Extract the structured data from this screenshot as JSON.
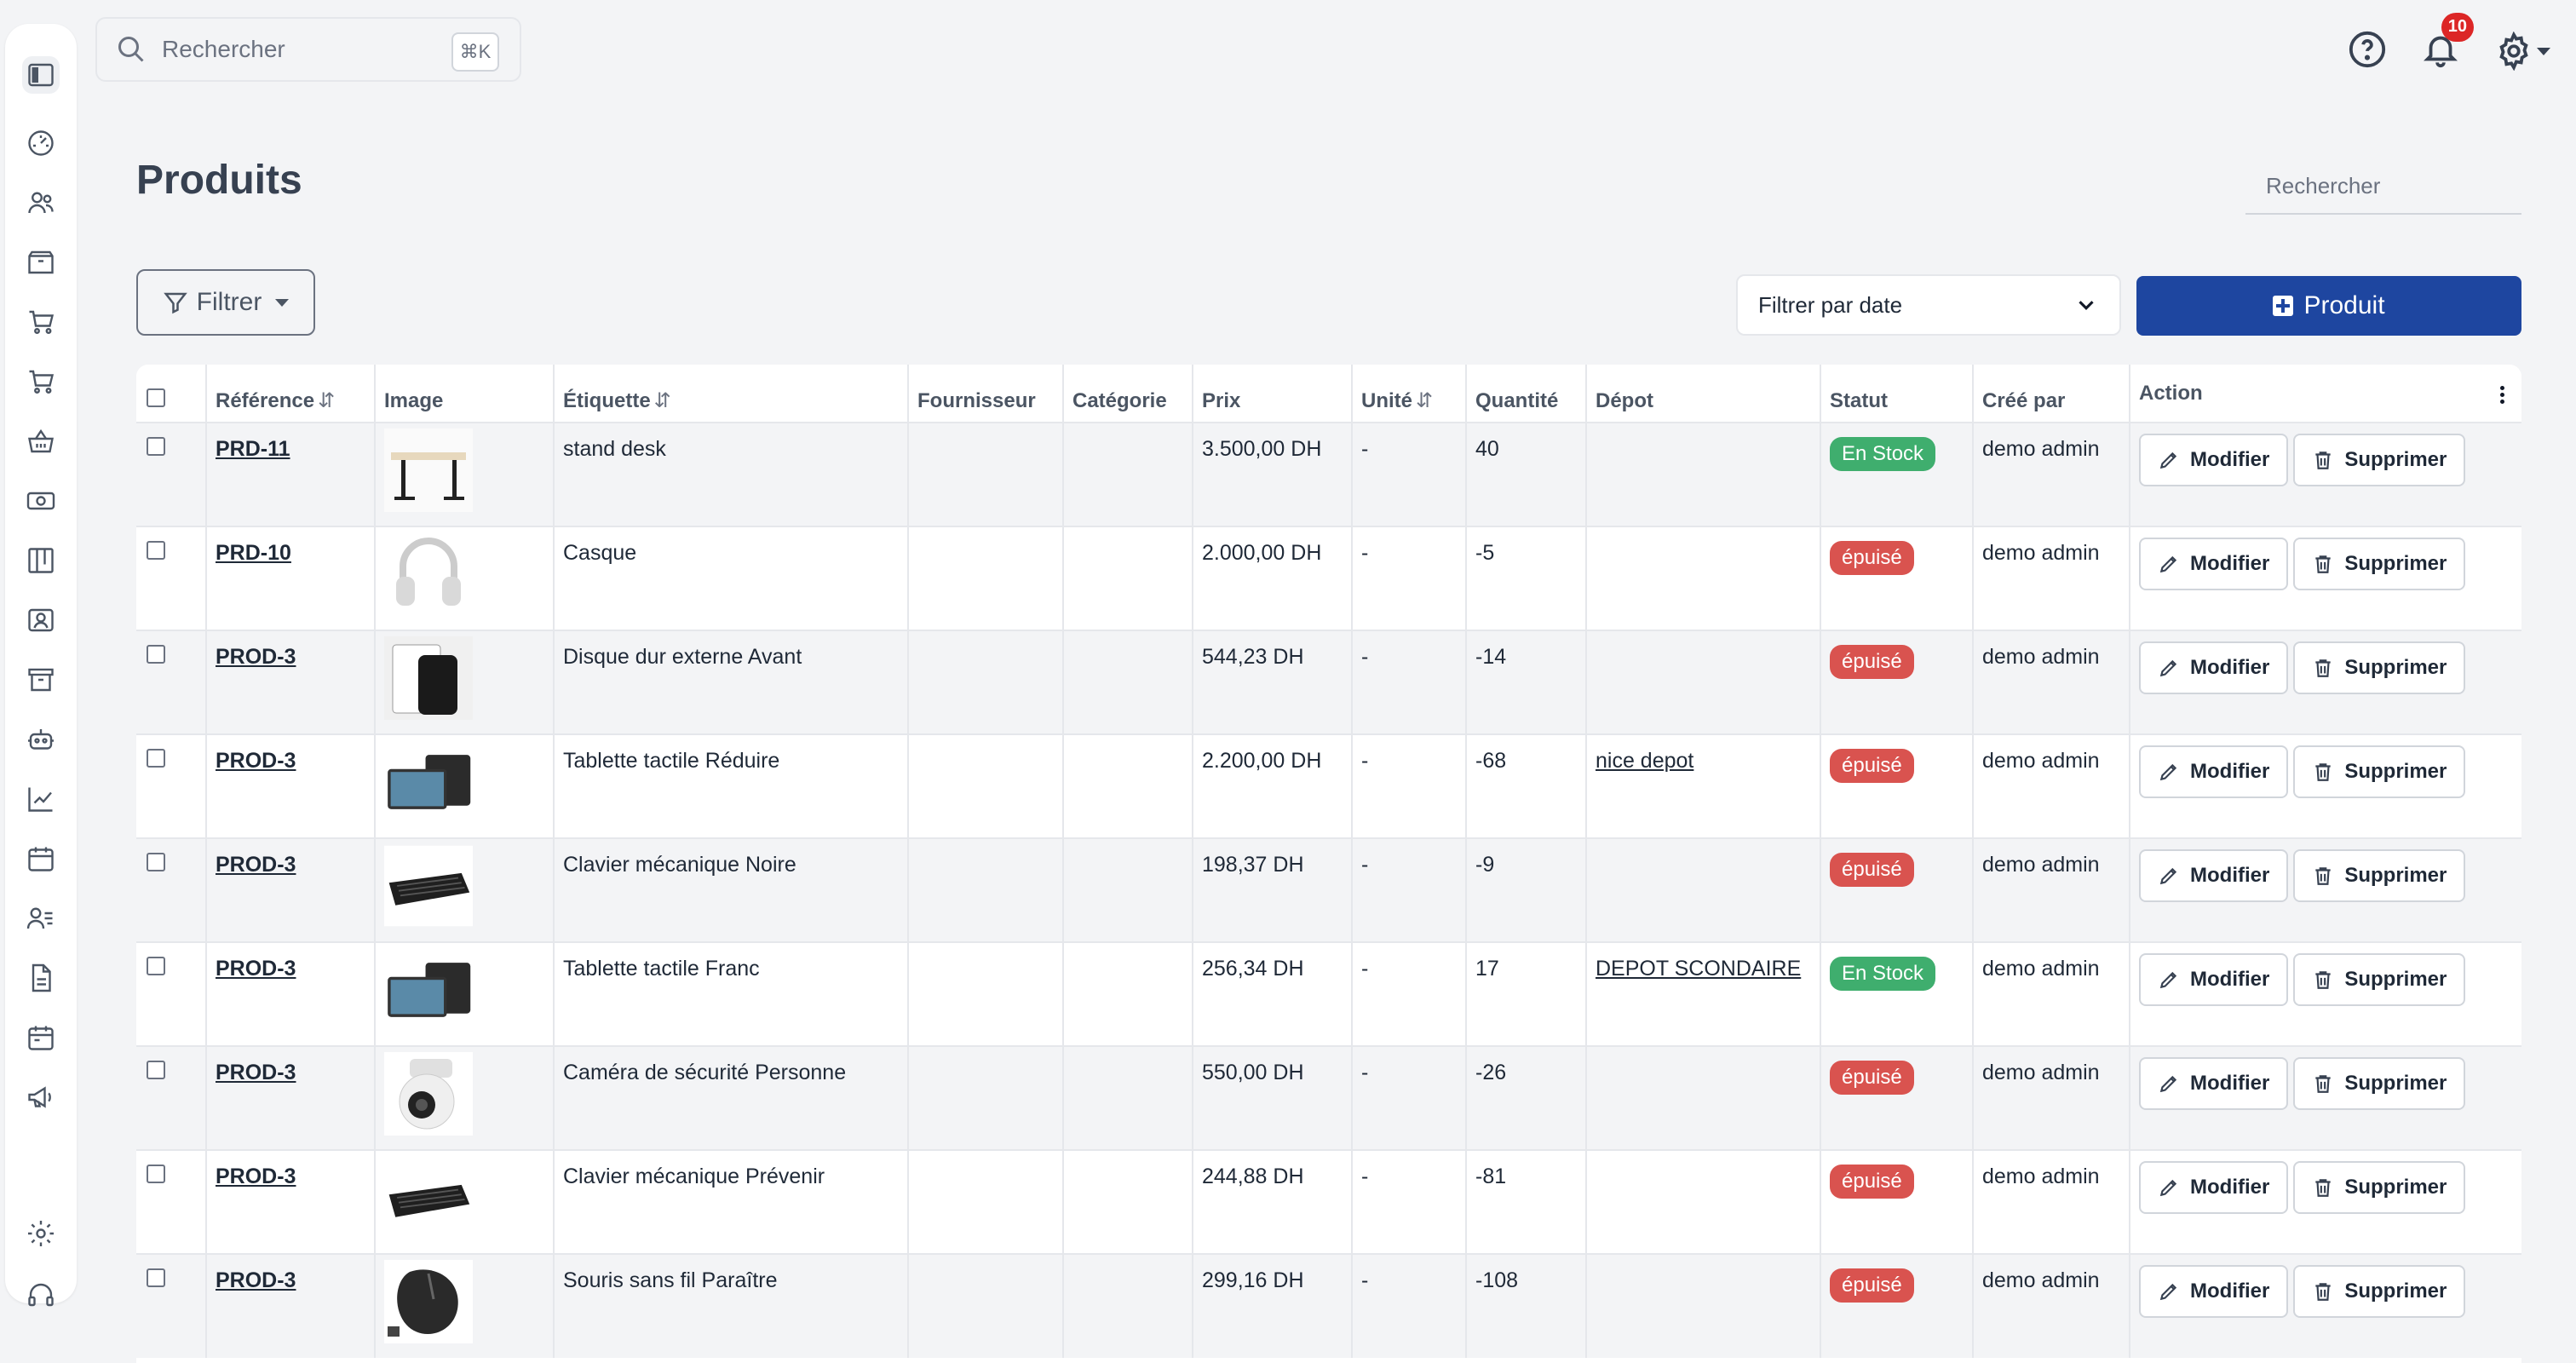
{
  "search": {
    "placeholder": "Rechercher",
    "shortcut": "⌘K"
  },
  "notifications": {
    "count": "10"
  },
  "page": {
    "title": "Produits",
    "search_placeholder": "Rechercher"
  },
  "toolbar": {
    "filter_label": "Filtrer",
    "date_filter_label": "Filtrer par date",
    "add_label": "Produit"
  },
  "table": {
    "headers": {
      "reference": "Référence",
      "image": "Image",
      "label": "Étiquette",
      "supplier": "Fournisseur",
      "category": "Catégorie",
      "price": "Prix",
      "unit": "Unité",
      "quantity": "Quantité",
      "depot": "Dépot",
      "status": "Statut",
      "created_by": "Créé par",
      "action": "Action"
    },
    "modify_label": "Modifier",
    "delete_label": "Supprimer",
    "rows": [
      {
        "ref": "PRD-11",
        "image": "desk",
        "label": "stand desk",
        "supplier": "",
        "category": "",
        "price": "3.500,00 DH",
        "unit": "-",
        "qty": "40",
        "depot": "",
        "status": "En Stock",
        "created_by": "demo admin"
      },
      {
        "ref": "PRD-10",
        "image": "headphones",
        "label": "Casque",
        "supplier": "",
        "category": "",
        "price": "2.000,00 DH",
        "unit": "-",
        "qty": "-5",
        "depot": "",
        "status": "épuisé",
        "created_by": "demo admin"
      },
      {
        "ref": "PROD-3",
        "image": "hard-drive",
        "label": "Disque dur externe Avant",
        "supplier": "",
        "category": "",
        "price": "544,23 DH",
        "unit": "-",
        "qty": "-14",
        "depot": "",
        "status": "épuisé",
        "created_by": "demo admin"
      },
      {
        "ref": "PROD-3",
        "image": "tablet",
        "label": "Tablette tactile Réduire",
        "supplier": "",
        "category": "",
        "price": "2.200,00 DH",
        "unit": "-",
        "qty": "-68",
        "depot": "nice depot",
        "status": "épuisé",
        "created_by": "demo admin"
      },
      {
        "ref": "PROD-3",
        "image": "keyboard",
        "label": "Clavier mécanique Noire",
        "supplier": "",
        "category": "",
        "price": "198,37 DH",
        "unit": "-",
        "qty": "-9",
        "depot": "",
        "status": "épuisé",
        "created_by": "demo admin"
      },
      {
        "ref": "PROD-3",
        "image": "tablet",
        "label": "Tablette tactile Franc",
        "supplier": "",
        "category": "",
        "price": "256,34 DH",
        "unit": "-",
        "qty": "17",
        "depot": "DEPOT SCONDAIRE",
        "status": "En Stock",
        "created_by": "demo admin"
      },
      {
        "ref": "PROD-3",
        "image": "camera",
        "label": "Caméra de sécurité Personne",
        "supplier": "",
        "category": "",
        "price": "550,00 DH",
        "unit": "-",
        "qty": "-26",
        "depot": "",
        "status": "épuisé",
        "created_by": "demo admin"
      },
      {
        "ref": "PROD-3",
        "image": "keyboard",
        "label": "Clavier mécanique Prévenir",
        "supplier": "",
        "category": "",
        "price": "244,88 DH",
        "unit": "-",
        "qty": "-81",
        "depot": "",
        "status": "épuisé",
        "created_by": "demo admin"
      },
      {
        "ref": "PROD-3",
        "image": "mouse",
        "label": "Souris sans fil Paraître",
        "supplier": "",
        "category": "",
        "price": "299,16 DH",
        "unit": "-",
        "qty": "-108",
        "depot": "",
        "status": "épuisé",
        "created_by": "demo admin"
      }
    ]
  },
  "sidebar": {
    "icons": [
      "sidebar-toggle-icon",
      "dashboard-icon",
      "users-icon",
      "box-icon",
      "cart-icon",
      "cart-icon",
      "basket-icon",
      "money-icon",
      "kanban-icon",
      "contact-card-icon",
      "archive-icon",
      "robot-icon",
      "chart-icon",
      "calendar-icon",
      "user-list-icon",
      "document-icon",
      "calendar-alt-icon",
      "megaphone-icon",
      "settings-icon",
      "headset-icon"
    ]
  },
  "colors": {
    "accent": "#1e46a0",
    "in_stock": "#3fae6e",
    "out_of_stock": "#d9534f",
    "notification": "#dc2626"
  }
}
